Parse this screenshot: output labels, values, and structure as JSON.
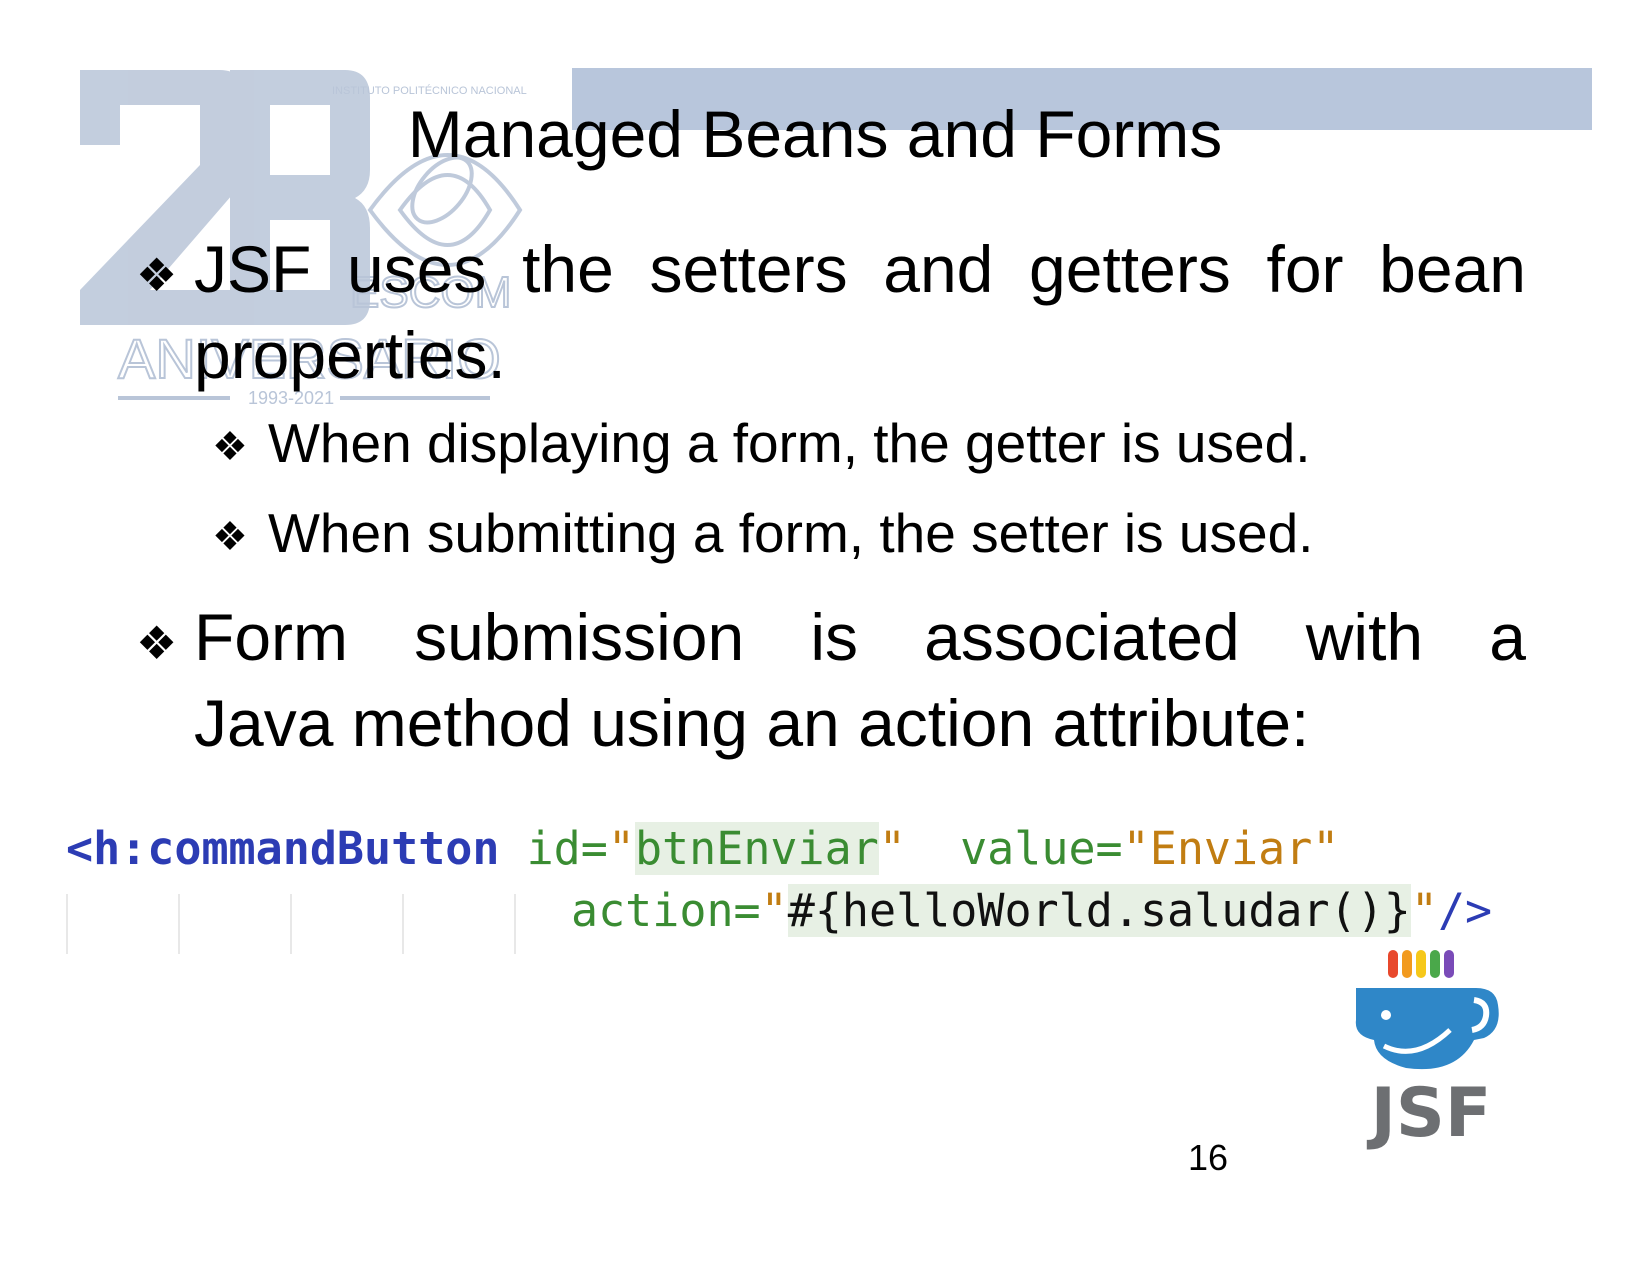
{
  "slide": {
    "title": "Managed Beans and Forms",
    "page_number": "16",
    "bullets": [
      {
        "level": 1,
        "text": "JSF uses the setters and getters for bean properties."
      },
      {
        "level": 2,
        "text": "When displaying a form, the getter is used."
      },
      {
        "level": 2,
        "text": "When submitting a form, the setter is used."
      },
      {
        "level": 1,
        "line1_words": [
          "Form",
          "submission",
          "is",
          "associated",
          "with",
          "a"
        ],
        "line2": "Java method using an action attribute:"
      }
    ],
    "bullet_glyph": "❖",
    "code": {
      "tag_open": "<h:commandButton",
      "id_attr": "id=",
      "q1": "\"",
      "id_value": "btnEnviar",
      "q2": "\"",
      "value_attr": "value=",
      "value_value": "\"Enviar\"",
      "action_attr": "action=",
      "q3": "\"",
      "action_value": "#{helloWorld.saludar()}",
      "q4": "\"",
      "tag_close": "/>"
    }
  },
  "watermark": {
    "number": "28",
    "institution": "INSTITUTO POLITÉCNICO NACIONAL",
    "school": "ESCOM",
    "word": "ANIVERSARIO",
    "years": "1993-2021"
  },
  "logo": {
    "text": "JSF",
    "icon": "jsf-coffee-cup-logo",
    "bar_colors": [
      "#e8482c",
      "#f29a1e",
      "#f6c81a",
      "#4aa84a",
      "#7a4bb8"
    ],
    "cup_color": "#2f87c8",
    "text_color": "#6d6f72"
  },
  "colors": {
    "title_bar": "#b8c6dc",
    "watermark": "#b9c5d8"
  }
}
